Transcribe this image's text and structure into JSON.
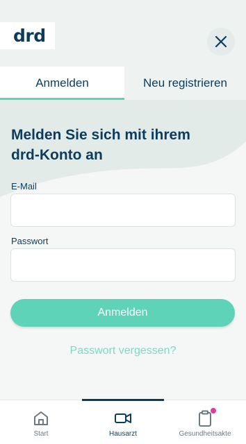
{
  "header": {
    "logo": "drd",
    "close_icon": "close-icon"
  },
  "tabs": [
    {
      "label": "Anmelden",
      "active": true
    },
    {
      "label": "Neu registrieren",
      "active": false
    }
  ],
  "form": {
    "title_line1": "Melden Sie sich mit ihrem",
    "title_line2": "drd-Konto an",
    "email_label": "E-Mail",
    "email_value": "",
    "password_label": "Passwort",
    "password_value": "",
    "submit_label": "Anmelden",
    "forgot_label": "Passwort vergessen?"
  },
  "bottom_nav": {
    "items": [
      {
        "label": "Start",
        "icon": "home-icon",
        "active": false
      },
      {
        "label": "Hausarzt",
        "icon": "video-camera-icon",
        "active": true
      },
      {
        "label": "Gesundheitsakte",
        "icon": "clipboard-icon",
        "active": false,
        "badge": true
      }
    ]
  },
  "colors": {
    "brand_dark": "#0b3c5d",
    "accent": "#5fd3b8",
    "badge": "#e6399b"
  }
}
